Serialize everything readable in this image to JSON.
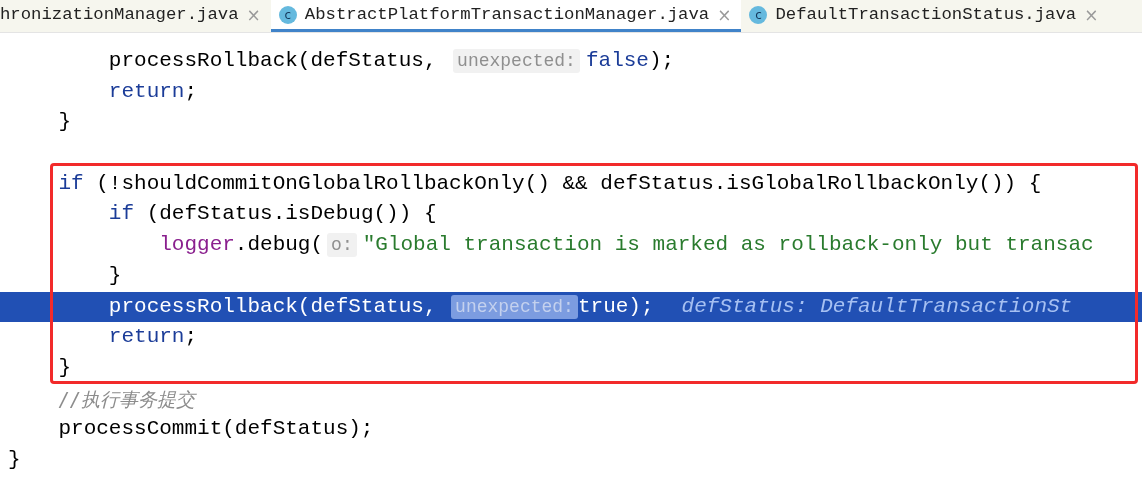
{
  "tabs": [
    {
      "label": "hronizationManager.java",
      "close": "×",
      "selected": false
    },
    {
      "label": "AbstractPlatformTransactionManager.java",
      "icon_letter": "c",
      "close": "×",
      "selected": true
    },
    {
      "label": "DefaultTransactionStatus.java",
      "icon_letter": "c",
      "close": "×",
      "selected": false
    }
  ],
  "blocks": [
    {
      "kind": "plain",
      "lines": [
        {
          "highlighted": false,
          "segments": [
            {
              "kind": "plain",
              "text": "        processRollback(defStatus, "
            },
            {
              "kind": "hint",
              "text": "unexpected:"
            },
            {
              "kind": "keyword",
              "text": "false"
            },
            {
              "kind": "plain",
              "text": ");"
            }
          ]
        },
        {
          "highlighted": false,
          "segments": [
            {
              "kind": "keyword",
              "text": "        return"
            },
            {
              "kind": "plain",
              "text": ";"
            }
          ]
        },
        {
          "highlighted": false,
          "segments": [
            {
              "kind": "plain",
              "text": "    }"
            }
          ]
        },
        {
          "highlighted": false
        }
      ]
    },
    {
      "kind": "annotated",
      "lines": [
        {
          "highlighted": false,
          "segments": [
            {
              "kind": "keyword",
              "text": "    if"
            },
            {
              "kind": "plain",
              "text": " (!shouldCommitOnGlobalRollbackOnly() && defStatus.isGlobalRollbackOnly()) {"
            }
          ]
        },
        {
          "highlighted": false,
          "segments": [
            {
              "kind": "keyword",
              "text": "        if"
            },
            {
              "kind": "plain",
              "text": " (defStatus.isDebug()) {"
            }
          ]
        },
        {
          "highlighted": false,
          "segments": [
            {
              "kind": "field",
              "text": "            logger"
            },
            {
              "kind": "plain",
              "text": ".debug("
            },
            {
              "kind": "hint",
              "text": "o:"
            },
            {
              "kind": "string",
              "text": "\"Global transaction is marked as rollback-only but transac"
            }
          ]
        },
        {
          "highlighted": false,
          "segments": [
            {
              "kind": "plain",
              "text": "        }"
            }
          ]
        },
        {
          "highlighted": true,
          "segments": [
            {
              "kind": "plain",
              "text": "        processRollback(defStatus, "
            },
            {
              "kind": "hint",
              "text": "unexpected:"
            },
            {
              "kind": "plain",
              "text": "true);"
            },
            {
              "kind": "value",
              "text": "defStatus: DefaultTransactionSt"
            }
          ]
        },
        {
          "highlighted": false,
          "segments": [
            {
              "kind": "keyword",
              "text": "        return"
            },
            {
              "kind": "plain",
              "text": ";"
            }
          ]
        },
        {
          "highlighted": false,
          "segments": [
            {
              "kind": "plain",
              "text": "    }"
            }
          ]
        }
      ]
    },
    {
      "kind": "plain",
      "lines": [
        {
          "highlighted": false,
          "segments": [
            {
              "kind": "comment",
              "text": "    //执行事务提交"
            }
          ]
        },
        {
          "highlighted": false,
          "segments": [
            {
              "kind": "plain",
              "text": "    processCommit(defStatus);"
            }
          ]
        },
        {
          "highlighted": false,
          "segments": [
            {
              "kind": "plain",
              "text": "}"
            }
          ]
        }
      ]
    }
  ]
}
